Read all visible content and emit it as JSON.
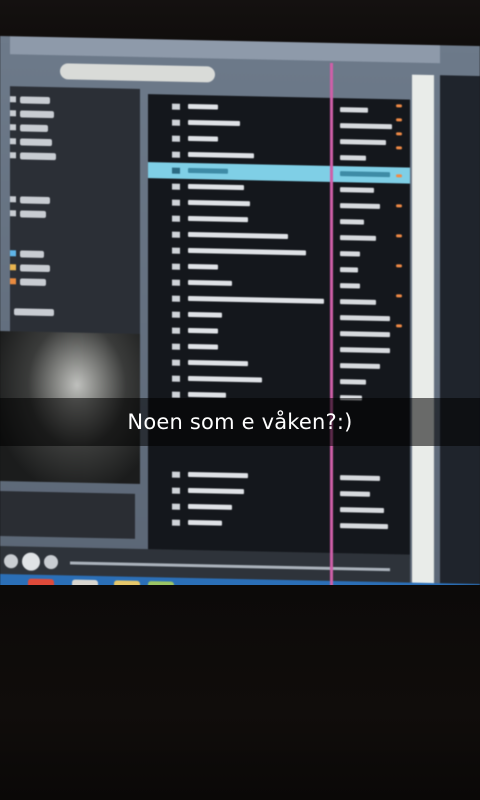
{
  "caption": {
    "text": "Noen som e våken?:)"
  },
  "scene": {
    "description_icon": "photo-of-monitor-icon",
    "colors": {
      "caption_bar": "#000000",
      "caption_text": "#ffffff",
      "selected_row": "#7fcfe6",
      "playhead_line": "#cf5fa8",
      "taskbar": "#2b6fb7"
    }
  }
}
